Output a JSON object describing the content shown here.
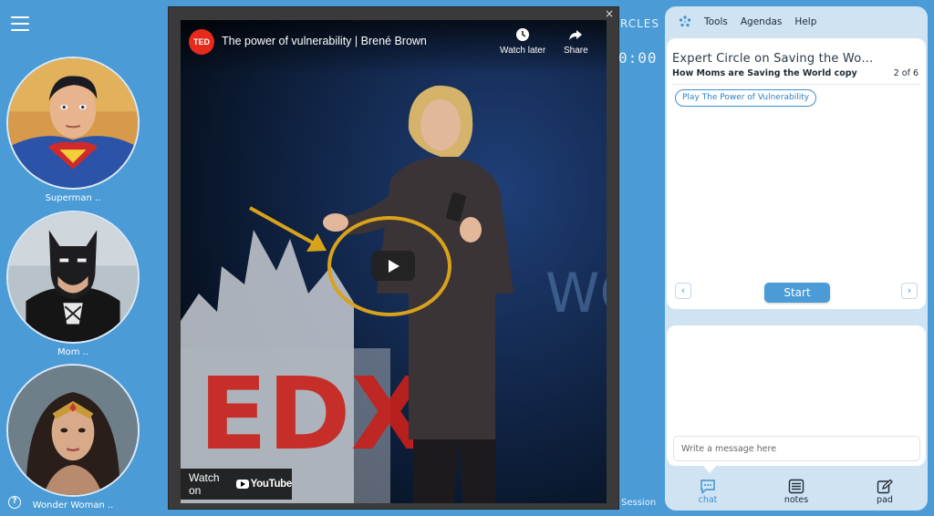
{
  "participants": [
    {
      "name": "Superman ..",
      "avatar_icon": "superman-avatar"
    },
    {
      "name": "Mom ..",
      "avatar_icon": "batman-avatar"
    },
    {
      "name": "Wonder Woman ..",
      "avatar_icon": "wonder-woman-avatar"
    }
  ],
  "background": {
    "circles_label": "RCLES",
    "timer": "0:00",
    "session_label": "Session"
  },
  "video": {
    "channel_logo": "TED",
    "title": "The power of vulnerability | Brené Brown",
    "watch_later": "Watch later",
    "share": "Share",
    "watch_on": "Watch on",
    "youtube": "YouTube",
    "stage_letters": "EDX",
    "stage_back": "WO"
  },
  "top_menu": {
    "tools": "Tools",
    "agendas": "Agendas",
    "help": "Help"
  },
  "agenda_card": {
    "title": "Expert Circle on Saving the Wor...",
    "subtitle": "How Moms are Saving the World copy",
    "count": "2 of 6",
    "activity": "Play The Power of Vulnerability",
    "start": "Start",
    "prev": "‹",
    "next": "›"
  },
  "chat": {
    "placeholder": "Write a message here"
  },
  "tabs": [
    {
      "label": "chat",
      "icon": "chat-icon"
    },
    {
      "label": "notes",
      "icon": "notes-icon"
    },
    {
      "label": "pad",
      "icon": "pad-icon"
    }
  ],
  "colors": {
    "background": "#4a9bd6",
    "accent": "#3d8fd0",
    "annotation": "#d9a21b",
    "ted_red": "#e62b1e"
  }
}
